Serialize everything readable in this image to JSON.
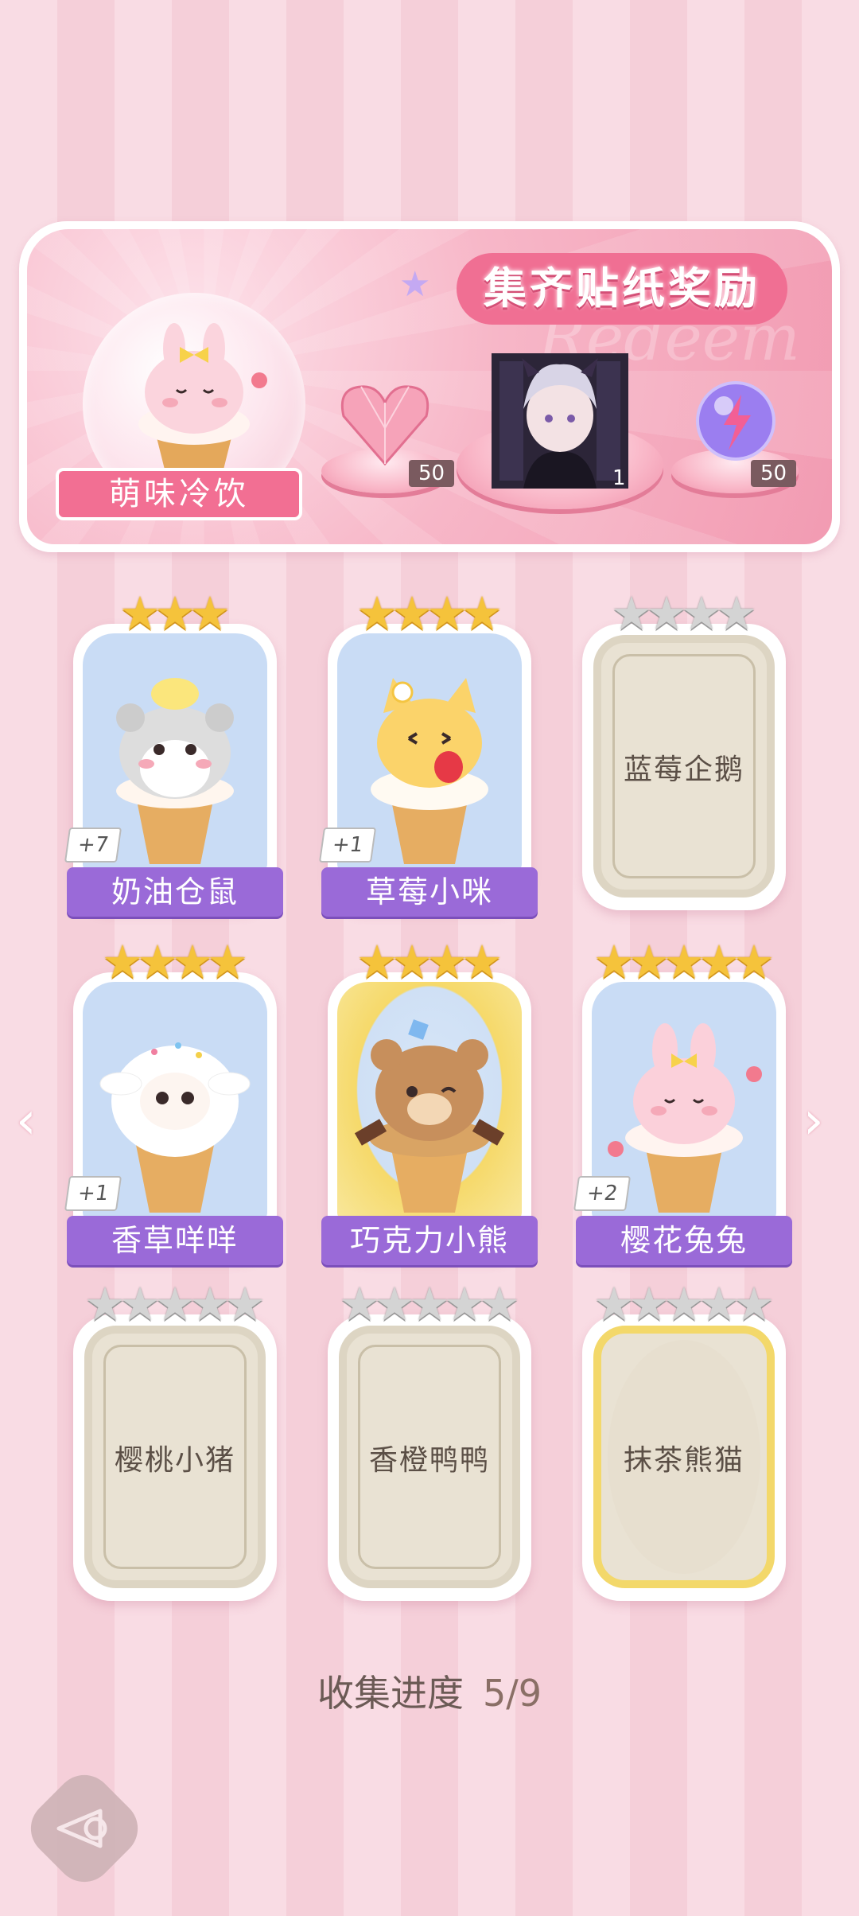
{
  "banner": {
    "title": "集齐贴纸奖励",
    "watermark": "Redeem",
    "theme_label": "萌味冷饮",
    "rewards": [
      {
        "icon": "pink-heart-gem-icon",
        "count": "50"
      },
      {
        "icon": "character-portrait",
        "count": "1"
      },
      {
        "icon": "lightning-orb-icon",
        "count": "50"
      }
    ]
  },
  "cards": [
    {
      "name": "奶油仓鼠",
      "stars": 3,
      "collected": true,
      "plus": "+7",
      "animal": "hamster"
    },
    {
      "name": "草莓小咪",
      "stars": 4,
      "collected": true,
      "plus": "+1",
      "animal": "cat"
    },
    {
      "name": "蓝莓企鹅",
      "stars": 4,
      "collected": false
    },
    {
      "name": "香草咩咩",
      "stars": 4,
      "collected": true,
      "plus": "+1",
      "animal": "sheep"
    },
    {
      "name": "巧克力小熊",
      "stars": 4,
      "collected": true,
      "animal": "bear",
      "gold": true
    },
    {
      "name": "樱花兔兔",
      "stars": 5,
      "collected": true,
      "plus": "+2",
      "animal": "bunny"
    },
    {
      "name": "樱桃小猪",
      "stars": 5,
      "collected": false
    },
    {
      "name": "香橙鸭鸭",
      "stars": 5,
      "collected": false
    },
    {
      "name": "抹茶熊猫",
      "stars": 5,
      "collected": false,
      "gold": true
    }
  ],
  "progress": {
    "label": "收集进度",
    "value": "5/9"
  },
  "nav": {
    "prev": "‹",
    "next": "›"
  }
}
